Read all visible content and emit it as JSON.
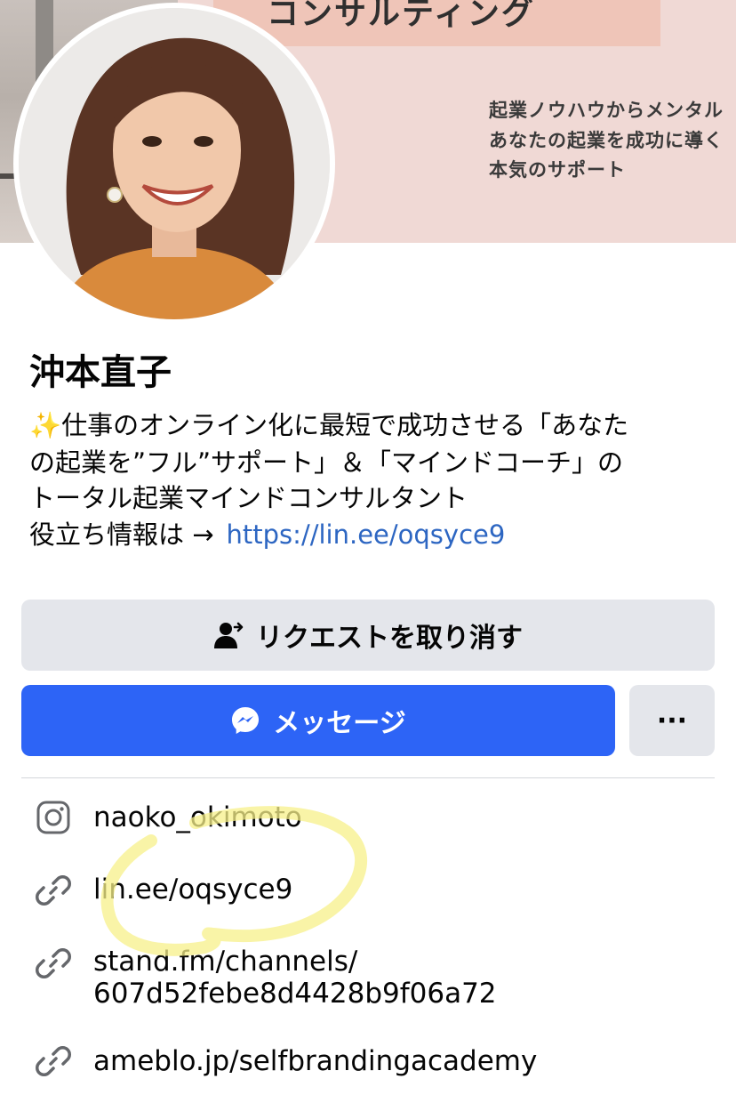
{
  "cover": {
    "banner_text": "コンサルティング",
    "lines": [
      "起業ノウハウからメンタル",
      "あなたの起業を成功に導く",
      "本気のサポート"
    ]
  },
  "profile": {
    "name": "沖本直子",
    "bio_lines": [
      "✨仕事のオンライン化に最短で成功させる「あなた",
      "の起業を”フル”サポート」＆「マインドコーチ」の",
      "トータル起業マインドコンサルタント"
    ],
    "info_prefix": "役立ち情報は →",
    "info_link": "https://lin.ee/oqsyce9"
  },
  "actions": {
    "cancel_request_label": "リクエストを取り消す",
    "message_label": "メッセージ",
    "more_label": "···"
  },
  "links": [
    {
      "icon": "instagram-icon",
      "text": "naoko_okimoto"
    },
    {
      "icon": "link-icon",
      "text": "lin.ee/oqsyce9"
    },
    {
      "icon": "link-icon",
      "text": "stand.fm/channels/",
      "text2": "607d52febe8d4428b9f06a72"
    },
    {
      "icon": "link-icon",
      "text": "ameblo.jp/selfbrandingacademy"
    }
  ],
  "colors": {
    "accent_blue": "#2d64f6",
    "link_blue": "#2d66c2",
    "button_gray": "#e4e6eb",
    "cover_pink": "#f0d9d5",
    "highlight_yellow": "#f7f08a"
  }
}
